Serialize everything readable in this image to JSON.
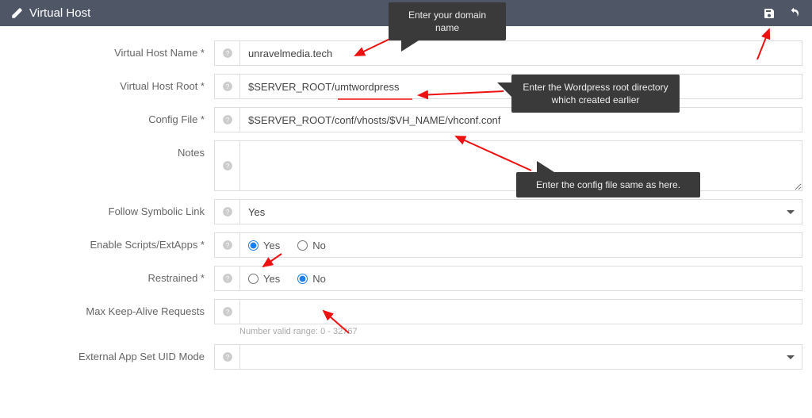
{
  "header": {
    "title": "Virtual Host"
  },
  "tooltips": {
    "domain": "Enter your domain name",
    "root": "Enter the Wordpress root directory which created earlier",
    "config": "Enter the config file same as here."
  },
  "fields": {
    "vhost_name": {
      "label": "Virtual Host Name *",
      "value": "unravelmedia.tech"
    },
    "vhost_root": {
      "label": "Virtual Host Root *",
      "value": "$SERVER_ROOT/umtwordpress"
    },
    "config_file": {
      "label": "Config File *",
      "value": "$SERVER_ROOT/conf/vhosts/$VH_NAME/vhconf.conf"
    },
    "notes": {
      "label": "Notes",
      "value": ""
    },
    "follow_symlink": {
      "label": "Follow Symbolic Link",
      "value": "Yes"
    },
    "enable_scripts": {
      "label": "Enable Scripts/ExtApps *",
      "yes": "Yes",
      "no": "No",
      "selected": "yes"
    },
    "restrained": {
      "label": "Restrained *",
      "yes": "Yes",
      "no": "No",
      "selected": "no"
    },
    "max_keepalive": {
      "label": "Max Keep-Alive Requests",
      "value": "",
      "hint": "Number valid range: 0 - 32767"
    },
    "ext_uid_mode": {
      "label": "External App Set UID Mode",
      "value": ""
    }
  }
}
